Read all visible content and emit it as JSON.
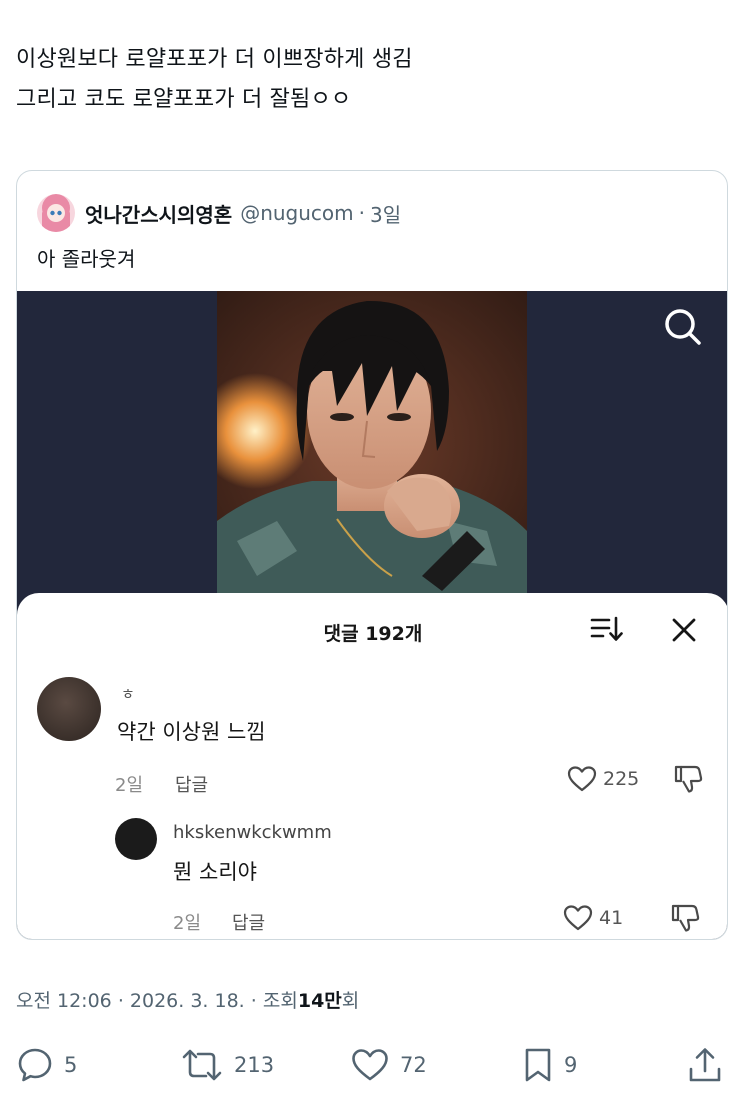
{
  "post": {
    "lines": [
      "이상원보다 로얄포포가 더 이쁘장하게 생김",
      "그리고 코도 로얄포포가 더 잘됨ㅇㅇ"
    ]
  },
  "quoted": {
    "name": "엇나간스시의영혼",
    "handle": "@nugucom",
    "separator": "·",
    "time": "3일",
    "text": "아 졸라웃겨"
  },
  "comments_sheet": {
    "title": "댓글 192개",
    "comments": [
      {
        "user": "ㅎ",
        "text": "약간 이상원 느낌",
        "time": "2일",
        "reply_label": "답글",
        "likes": "225"
      },
      {
        "user": "hkskenwkckwmm",
        "text": "뭔 소리야",
        "time": "2일",
        "reply_label": "답글",
        "likes": "41"
      }
    ]
  },
  "meta": {
    "time": "오전 12:06",
    "sep1": "·",
    "date": "2026. 3. 18.",
    "sep2": "·",
    "views_prefix": "조회",
    "views_number": "14만",
    "views_suffix": "회"
  },
  "actions": {
    "replies": "5",
    "reposts": "213",
    "likes": "72",
    "bookmarks": "9"
  },
  "colors": {
    "text": "#0f1419",
    "secondary": "#536471",
    "border": "#cfd9de",
    "media_bg": "#22273b"
  },
  "icons": [
    "search-icon",
    "sort-icon",
    "close-icon",
    "heart-icon",
    "dislike-icon",
    "reply-icon",
    "repost-icon",
    "like-icon",
    "bookmark-icon",
    "share-icon"
  ]
}
